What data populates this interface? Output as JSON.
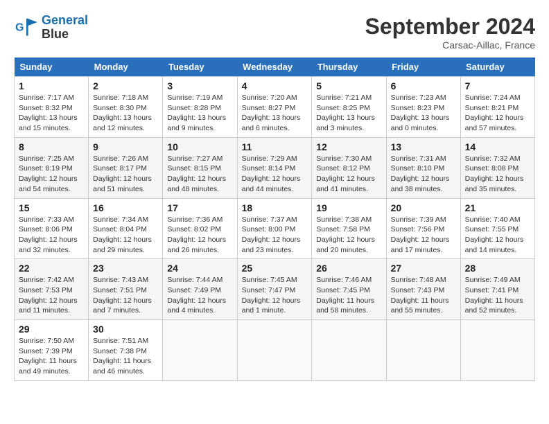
{
  "header": {
    "logo_line1": "General",
    "logo_line2": "Blue",
    "month": "September 2024",
    "location": "Carsac-Aillac, France"
  },
  "columns": [
    "Sunday",
    "Monday",
    "Tuesday",
    "Wednesday",
    "Thursday",
    "Friday",
    "Saturday"
  ],
  "weeks": [
    [
      {
        "day": "1",
        "info": "Sunrise: 7:17 AM\nSunset: 8:32 PM\nDaylight: 13 hours\nand 15 minutes."
      },
      {
        "day": "2",
        "info": "Sunrise: 7:18 AM\nSunset: 8:30 PM\nDaylight: 13 hours\nand 12 minutes."
      },
      {
        "day": "3",
        "info": "Sunrise: 7:19 AM\nSunset: 8:28 PM\nDaylight: 13 hours\nand 9 minutes."
      },
      {
        "day": "4",
        "info": "Sunrise: 7:20 AM\nSunset: 8:27 PM\nDaylight: 13 hours\nand 6 minutes."
      },
      {
        "day": "5",
        "info": "Sunrise: 7:21 AM\nSunset: 8:25 PM\nDaylight: 13 hours\nand 3 minutes."
      },
      {
        "day": "6",
        "info": "Sunrise: 7:23 AM\nSunset: 8:23 PM\nDaylight: 13 hours\nand 0 minutes."
      },
      {
        "day": "7",
        "info": "Sunrise: 7:24 AM\nSunset: 8:21 PM\nDaylight: 12 hours\nand 57 minutes."
      }
    ],
    [
      {
        "day": "8",
        "info": "Sunrise: 7:25 AM\nSunset: 8:19 PM\nDaylight: 12 hours\nand 54 minutes."
      },
      {
        "day": "9",
        "info": "Sunrise: 7:26 AM\nSunset: 8:17 PM\nDaylight: 12 hours\nand 51 minutes."
      },
      {
        "day": "10",
        "info": "Sunrise: 7:27 AM\nSunset: 8:15 PM\nDaylight: 12 hours\nand 48 minutes."
      },
      {
        "day": "11",
        "info": "Sunrise: 7:29 AM\nSunset: 8:14 PM\nDaylight: 12 hours\nand 44 minutes."
      },
      {
        "day": "12",
        "info": "Sunrise: 7:30 AM\nSunset: 8:12 PM\nDaylight: 12 hours\nand 41 minutes."
      },
      {
        "day": "13",
        "info": "Sunrise: 7:31 AM\nSunset: 8:10 PM\nDaylight: 12 hours\nand 38 minutes."
      },
      {
        "day": "14",
        "info": "Sunrise: 7:32 AM\nSunset: 8:08 PM\nDaylight: 12 hours\nand 35 minutes."
      }
    ],
    [
      {
        "day": "15",
        "info": "Sunrise: 7:33 AM\nSunset: 8:06 PM\nDaylight: 12 hours\nand 32 minutes."
      },
      {
        "day": "16",
        "info": "Sunrise: 7:34 AM\nSunset: 8:04 PM\nDaylight: 12 hours\nand 29 minutes."
      },
      {
        "day": "17",
        "info": "Sunrise: 7:36 AM\nSunset: 8:02 PM\nDaylight: 12 hours\nand 26 minutes."
      },
      {
        "day": "18",
        "info": "Sunrise: 7:37 AM\nSunset: 8:00 PM\nDaylight: 12 hours\nand 23 minutes."
      },
      {
        "day": "19",
        "info": "Sunrise: 7:38 AM\nSunset: 7:58 PM\nDaylight: 12 hours\nand 20 minutes."
      },
      {
        "day": "20",
        "info": "Sunrise: 7:39 AM\nSunset: 7:56 PM\nDaylight: 12 hours\nand 17 minutes."
      },
      {
        "day": "21",
        "info": "Sunrise: 7:40 AM\nSunset: 7:55 PM\nDaylight: 12 hours\nand 14 minutes."
      }
    ],
    [
      {
        "day": "22",
        "info": "Sunrise: 7:42 AM\nSunset: 7:53 PM\nDaylight: 12 hours\nand 11 minutes."
      },
      {
        "day": "23",
        "info": "Sunrise: 7:43 AM\nSunset: 7:51 PM\nDaylight: 12 hours\nand 7 minutes."
      },
      {
        "day": "24",
        "info": "Sunrise: 7:44 AM\nSunset: 7:49 PM\nDaylight: 12 hours\nand 4 minutes."
      },
      {
        "day": "25",
        "info": "Sunrise: 7:45 AM\nSunset: 7:47 PM\nDaylight: 12 hours\nand 1 minute."
      },
      {
        "day": "26",
        "info": "Sunrise: 7:46 AM\nSunset: 7:45 PM\nDaylight: 11 hours\nand 58 minutes."
      },
      {
        "day": "27",
        "info": "Sunrise: 7:48 AM\nSunset: 7:43 PM\nDaylight: 11 hours\nand 55 minutes."
      },
      {
        "day": "28",
        "info": "Sunrise: 7:49 AM\nSunset: 7:41 PM\nDaylight: 11 hours\nand 52 minutes."
      }
    ],
    [
      {
        "day": "29",
        "info": "Sunrise: 7:50 AM\nSunset: 7:39 PM\nDaylight: 11 hours\nand 49 minutes."
      },
      {
        "day": "30",
        "info": "Sunrise: 7:51 AM\nSunset: 7:38 PM\nDaylight: 11 hours\nand 46 minutes."
      },
      {
        "day": "",
        "info": ""
      },
      {
        "day": "",
        "info": ""
      },
      {
        "day": "",
        "info": ""
      },
      {
        "day": "",
        "info": ""
      },
      {
        "day": "",
        "info": ""
      }
    ]
  ]
}
